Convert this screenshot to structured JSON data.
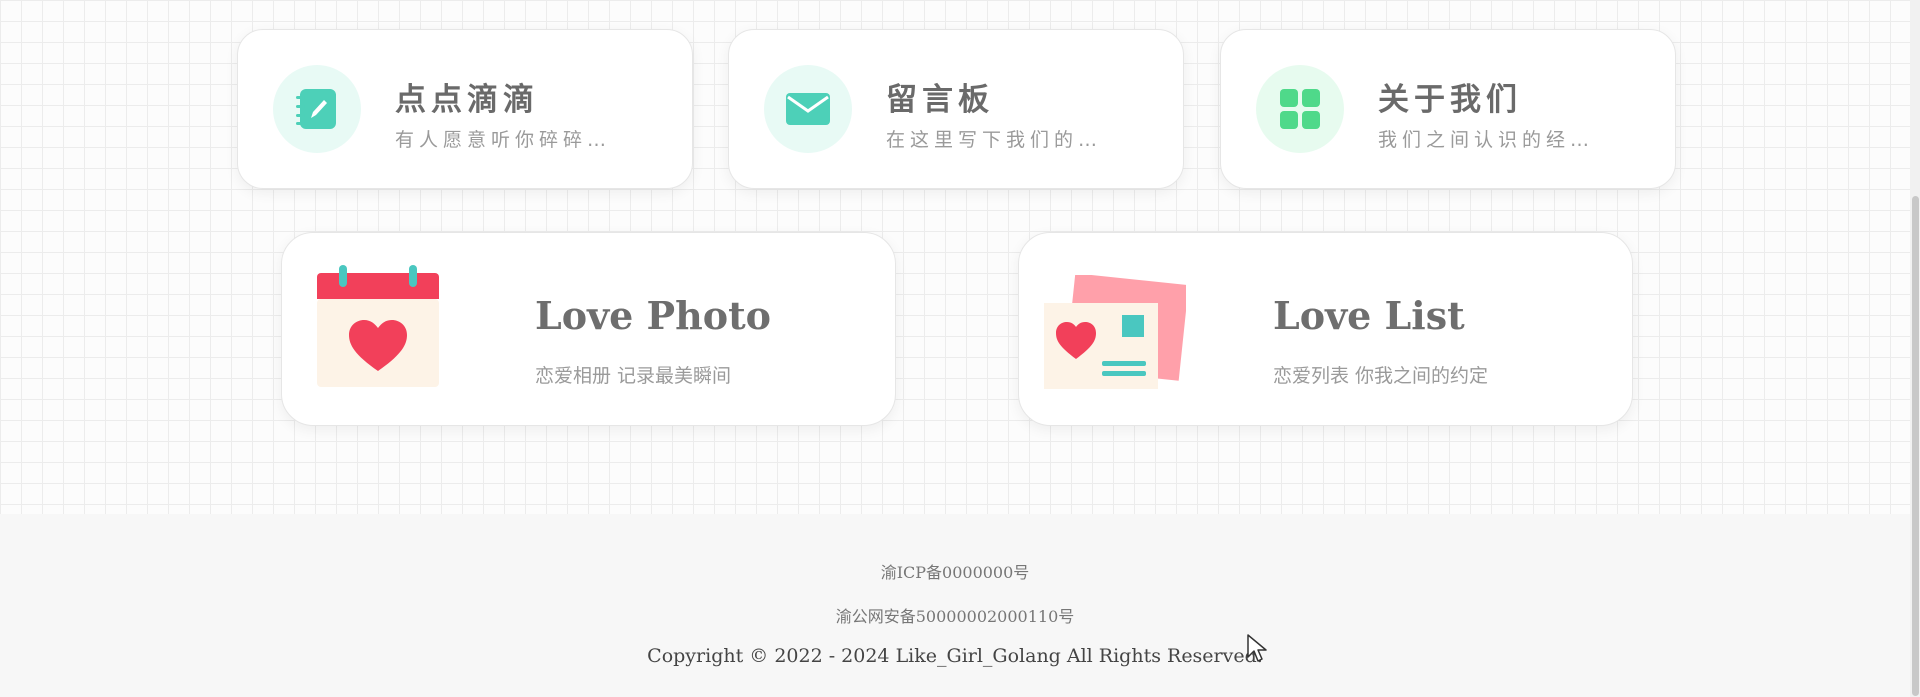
{
  "cards": [
    {
      "title": "点点滴滴",
      "subtitle": "有人愿意听你碎碎…",
      "icon": "notebook-pen-icon",
      "icon_bg": "#e8faf5",
      "icon_color": "#4dd0b8"
    },
    {
      "title": "留言板",
      "subtitle": "在这里写下我们的…",
      "icon": "envelope-icon",
      "icon_bg": "#e8faf5",
      "icon_color": "#4dd0b8"
    },
    {
      "title": "关于我们",
      "subtitle": "我们之间认识的经…",
      "icon": "grid-apps-icon",
      "icon_bg": "#e7fbef",
      "icon_color": "#4fd98a"
    }
  ],
  "feature_cards": [
    {
      "title": "Love Photo",
      "subtitle": "恋爱相册 记录最美瞬间",
      "icon": "calendar-heart-icon"
    },
    {
      "title": "Love List",
      "subtitle": "恋爱列表 你我之间的约定",
      "icon": "photo-cards-heart-icon"
    }
  ],
  "footer": {
    "icp": "渝ICP备0000000号",
    "police": "渝公网安备50000002000110号",
    "copyright": "Copyright © 2022 - 2024 Like_Girl_Golang All Rights Reserved."
  }
}
